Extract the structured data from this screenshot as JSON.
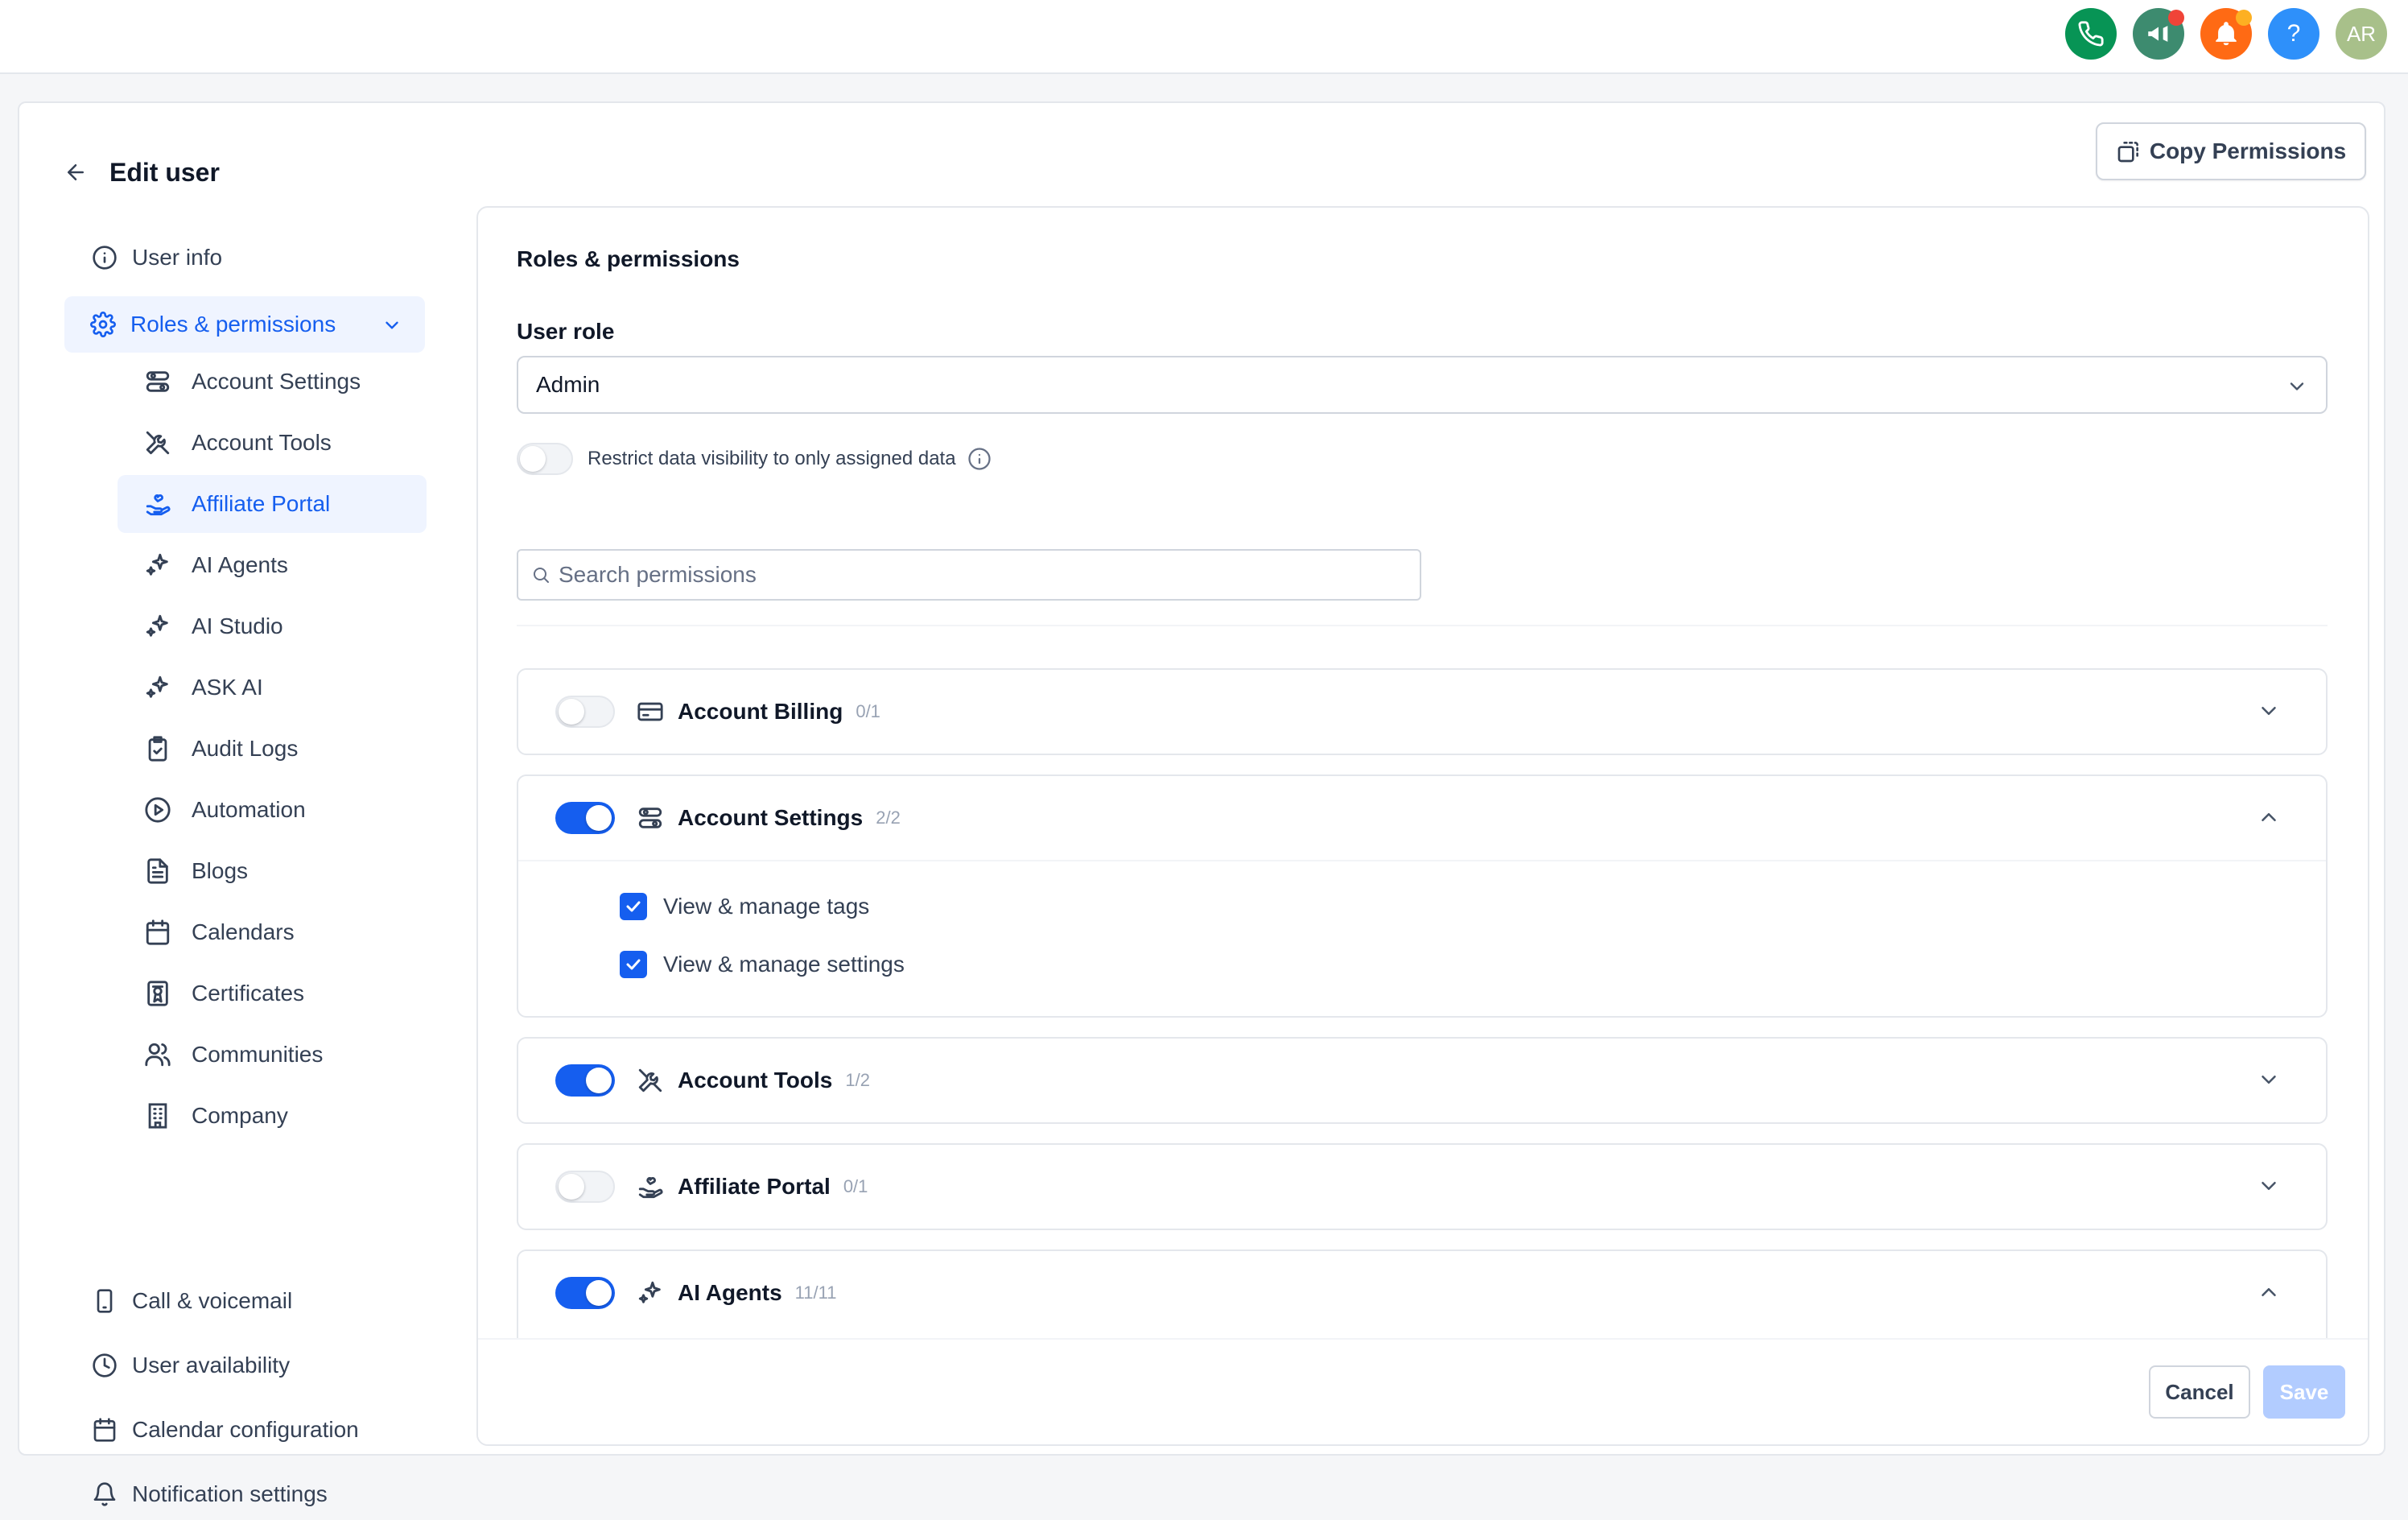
{
  "topbar": {
    "buttons": [
      {
        "icon": "phone-icon",
        "color": "#079455"
      },
      {
        "icon": "megaphone-icon",
        "color": "#3d8b6f",
        "badge_color": "#f04438"
      },
      {
        "icon": "bell-icon",
        "color": "#ff6a14",
        "badge_color": "#fdb022"
      },
      {
        "icon": "help-icon",
        "color": "#2e90fa",
        "label": "?"
      },
      {
        "icon": "avatar",
        "color": "#a8c08a",
        "label": "AR"
      }
    ]
  },
  "header": {
    "title": "Edit user",
    "copy_button": "Copy Permissions"
  },
  "sidebar": {
    "top_items": [
      {
        "label": "User info",
        "icon": "info-circle-icon"
      },
      {
        "label": "Roles & permissions",
        "icon": "gear-icon",
        "active": true
      }
    ],
    "sub_items": [
      {
        "label": "Account Settings",
        "icon": "settings-toggles-icon"
      },
      {
        "label": "Account Tools",
        "icon": "tools-icon"
      },
      {
        "label": "Affiliate Portal",
        "icon": "hand-heart-icon",
        "active": true
      },
      {
        "label": "AI Agents",
        "icon": "sparkles-icon"
      },
      {
        "label": "AI Studio",
        "icon": "sparkles-icon"
      },
      {
        "label": "ASK AI",
        "icon": "sparkles-icon"
      },
      {
        "label": "Audit Logs",
        "icon": "clipboard-check-icon"
      },
      {
        "label": "Automation",
        "icon": "play-circle-icon"
      },
      {
        "label": "Blogs",
        "icon": "file-text-icon"
      },
      {
        "label": "Calendars",
        "icon": "calendar-icon"
      },
      {
        "label": "Certificates",
        "icon": "certificate-icon"
      },
      {
        "label": "Communities",
        "icon": "users-icon"
      },
      {
        "label": "Company",
        "icon": "building-icon"
      }
    ],
    "bottom_items": [
      {
        "label": "Call & voicemail",
        "icon": "phone-device-icon"
      },
      {
        "label": "User availability",
        "icon": "clock-icon"
      },
      {
        "label": "Calendar configuration",
        "icon": "calendar-icon"
      },
      {
        "label": "Notification settings",
        "icon": "bell-icon"
      }
    ]
  },
  "main": {
    "section_title": "Roles & permissions",
    "user_role_label": "User role",
    "user_role_value": "Admin",
    "restrict_label": "Restrict data visibility to only assigned data",
    "restrict_enabled": false,
    "search_placeholder": "Search permissions",
    "permissions": [
      {
        "name": "Account Billing",
        "count": "0/1",
        "enabled": false,
        "expanded": false,
        "icon": "credit-card-icon"
      },
      {
        "name": "Account Settings",
        "count": "2/2",
        "enabled": true,
        "expanded": true,
        "icon": "settings-toggles-icon",
        "items": [
          {
            "label": "View & manage tags",
            "checked": true
          },
          {
            "label": "View & manage settings",
            "checked": true
          }
        ]
      },
      {
        "name": "Account Tools",
        "count": "1/2",
        "enabled": true,
        "expanded": false,
        "icon": "tools-icon"
      },
      {
        "name": "Affiliate Portal",
        "count": "0/1",
        "enabled": false,
        "expanded": false,
        "icon": "hand-heart-icon"
      },
      {
        "name": "AI Agents",
        "count": "11/11",
        "enabled": true,
        "expanded": true,
        "icon": "sparkles-icon"
      }
    ],
    "cancel_label": "Cancel",
    "save_label": "Save"
  },
  "colors": {
    "accent": "#155eef",
    "accent_disabled": "#b2ccff"
  }
}
